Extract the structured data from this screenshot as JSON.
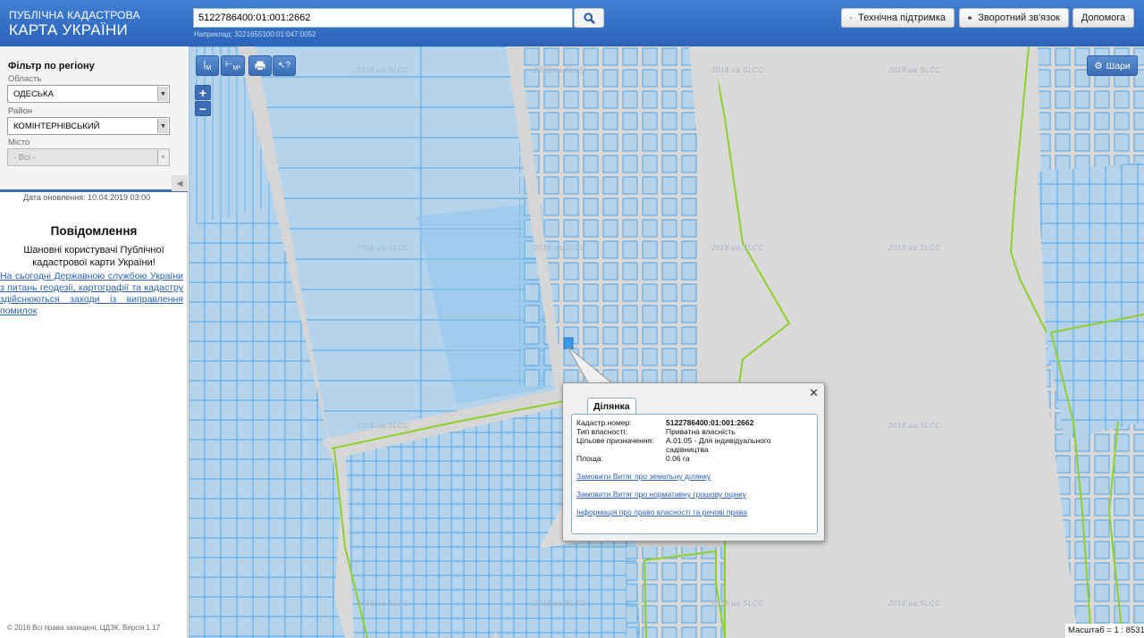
{
  "header": {
    "logo_line1": "ПУБЛІЧНА КАДАСТРОВА",
    "logo_line2": "КАРТА УКРАЇНИ",
    "search_value": "5122786400:01:001:2662",
    "search_hint": "Наприклад: 3221655100:01:047:0052",
    "buttons": {
      "support": "Технічна підтримка",
      "feedback": "Зворотний зв'язок",
      "help": "Допомога"
    }
  },
  "sidebar": {
    "filter_title": "Фільтр по регіону",
    "oblast_label": "Область",
    "oblast_value": "ОДЕСЬКА",
    "rayon_label": "Район",
    "rayon_value": "КОМІНТЕРНІВСЬКИЙ",
    "misto_label": "Місто",
    "misto_value": "- Всі -",
    "updated": "Дата оновлення: 10.04.2019 03:00",
    "news_title": "Повідомлення",
    "news_greeting": "Шановні користувачі Публічної кадастрової карти України!",
    "news_link": "На сьогодні Державною службою України з питань геодезії, картографії та кадастру здійснюються заходи із виправлення помилок",
    "copyright": "© 2016 Всі права захищені. ЦДЗК. Версія 1.17"
  },
  "map": {
    "toolbar": {
      "measure_label": "M",
      "area_label": "M²"
    },
    "layers_label": "Шари",
    "watermark": "2018.ua.SLCC",
    "scale": "Масштаб = 1 : 8531",
    "colors": {
      "parcel_fill": "#b5d4ec",
      "parcel_stroke": "#56a6e2",
      "boundary": "#8fd12a",
      "road": "#d6d6d6"
    }
  },
  "popup": {
    "tab": "Ділянка",
    "rows": [
      {
        "key": "Кадастр.номер:",
        "value": "5122786400:01:001:2662"
      },
      {
        "key": "Тип власності:",
        "value": "Приватна власність"
      },
      {
        "key": "Цільове призначення:",
        "value": "А.01.05 - Для індивідуального садівництва"
      },
      {
        "key": "Площа:",
        "value": "0.06 га"
      }
    ],
    "links": [
      "Замовити Витяг про земельну ділянку",
      "Замовити Витяг про нормативну грошову оцінку",
      "Інформація про право власності та речові права"
    ]
  }
}
